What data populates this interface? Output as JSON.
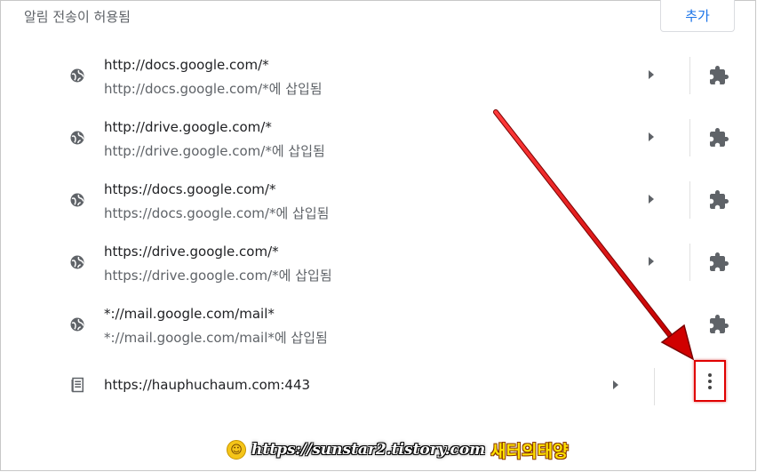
{
  "section": {
    "title": "알림 전송이 허용됨",
    "add_label": "추가"
  },
  "sites": [
    {
      "url": "http://docs.google.com/*",
      "source": "http://docs.google.com/*에 삽입됨"
    },
    {
      "url": "http://drive.google.com/*",
      "source": "http://drive.google.com/*에 삽입됨"
    },
    {
      "url": "https://docs.google.com/*",
      "source": "https://docs.google.com/*에 삽입됨"
    },
    {
      "url": "https://drive.google.com/*",
      "source": "https://drive.google.com/*에 삽입됨"
    },
    {
      "url": "*://mail.google.com/mail*",
      "source": "*://mail.google.com/mail*에 삽입됨"
    },
    {
      "url": "https://hauphuchaum.com:443"
    }
  ],
  "watermark": {
    "url": "https://sunstar2.tistory.com",
    "name": "새터의태양"
  },
  "colors": {
    "accent": "#1a73e8",
    "annotation": "#e00000"
  },
  "icons": {
    "site": "globe-icon",
    "extension": "puzzle-icon",
    "site_last": "document-icon",
    "more": "more-vert-icon"
  }
}
